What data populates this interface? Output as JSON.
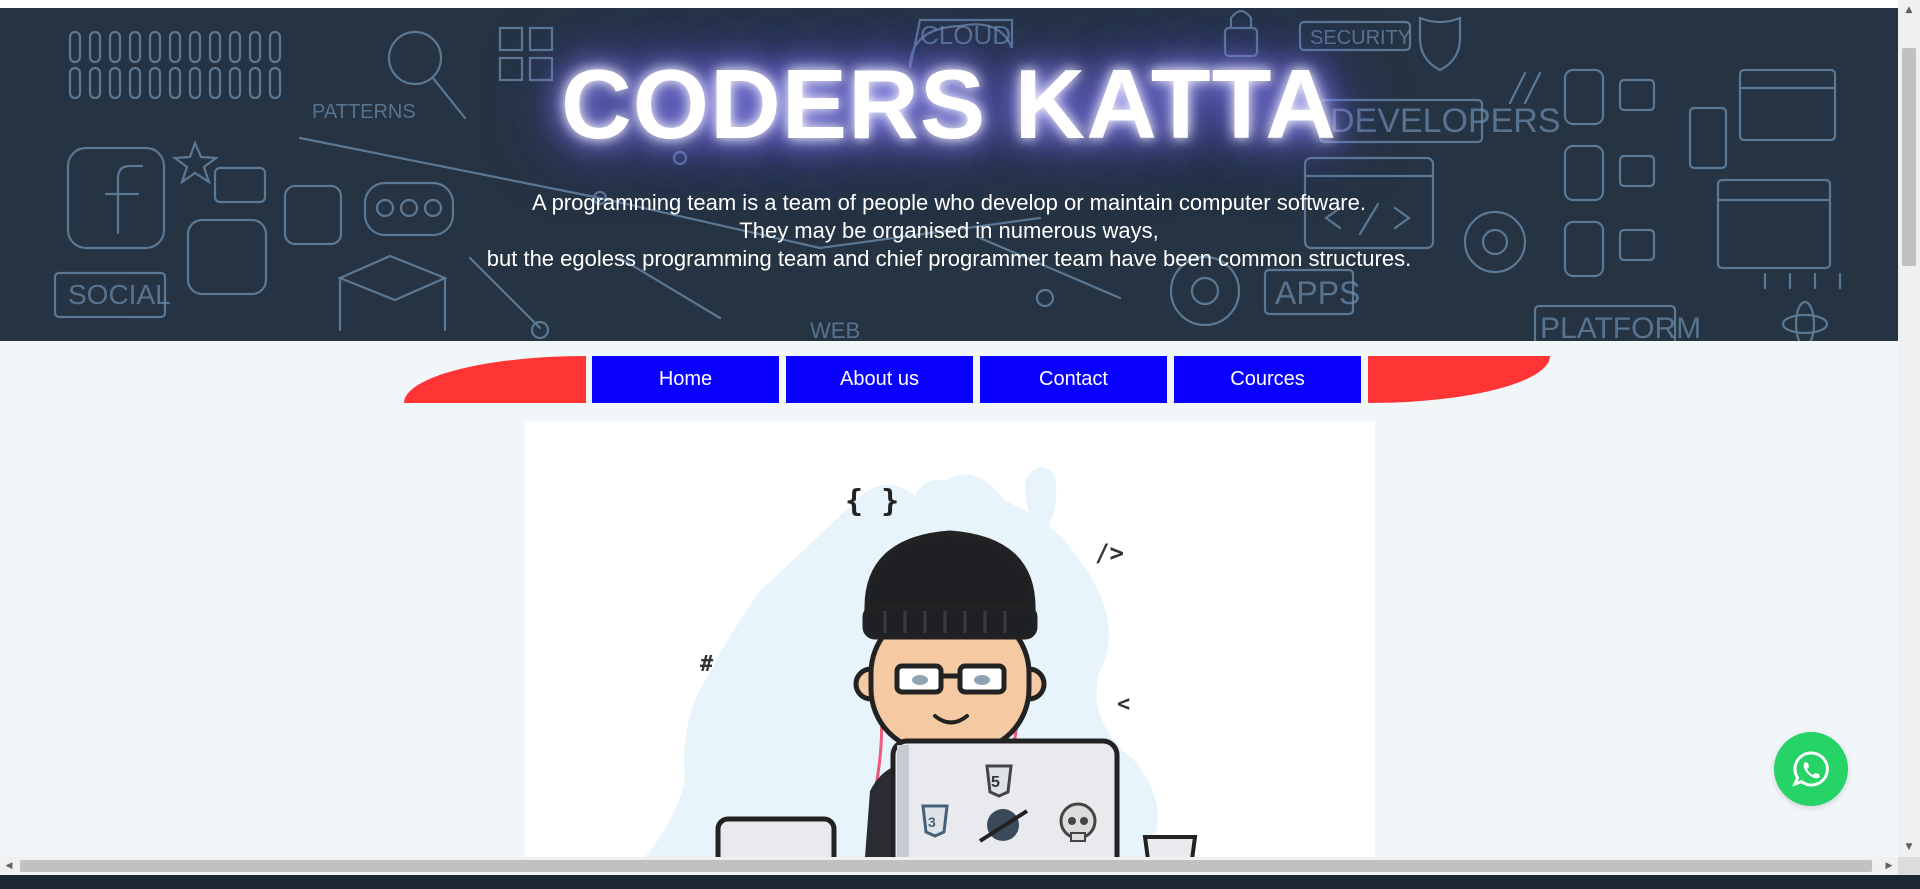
{
  "hero": {
    "title": "CODERS KATTA",
    "subtitle_lines": [
      "A programming team is a team of people who develop or maintain computer software.",
      "They may be organised in numerous ways,",
      "but the egoless programming team and chief programmer team have been common structures."
    ],
    "doodle_words": [
      "PATTERNS",
      "SOCIAL",
      "CLOUD",
      "SECURITY",
      "DEVELOPERS",
      "APPS",
      "PLATFORM",
      "WEB"
    ]
  },
  "nav": {
    "items": [
      {
        "label": "Home"
      },
      {
        "label": "About us"
      },
      {
        "label": "Contact"
      },
      {
        "label": "Cources"
      }
    ]
  },
  "illustration": {
    "glyphs": [
      "{ }",
      "/>",
      "#",
      "<"
    ],
    "laptop_badges": [
      "5",
      "3"
    ]
  },
  "floating": {
    "icon": "whatsapp-icon"
  },
  "colors": {
    "hero_bg": "#253342",
    "nav_button": "#0a00ff",
    "nav_wing": "#ff3535",
    "whatsapp": "#25d366",
    "page_bg": "#f1f6f9"
  }
}
